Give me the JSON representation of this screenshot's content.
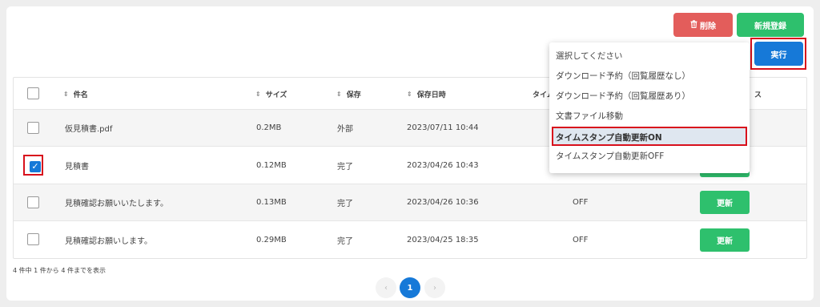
{
  "toolbar": {
    "delete_label": "削除",
    "new_label": "新規登録",
    "exec_label": "実行"
  },
  "table": {
    "headers": [
      "件名",
      "サイズ",
      "保存",
      "保存日時",
      "タイム",
      "ス"
    ],
    "rows": [
      {
        "name": "仮見積書.pdf",
        "size": "0.2MB",
        "storage": "外部",
        "date": "2023/07/11 10:44",
        "timestamp": "",
        "checked": false
      },
      {
        "name": "見積書",
        "size": "0.12MB",
        "storage": "完了",
        "date": "2023/04/26 10:43",
        "timestamp": "",
        "checked": true
      },
      {
        "name": "見積確認お願いいたします。",
        "size": "0.13MB",
        "storage": "完了",
        "date": "2023/04/26 10:36",
        "timestamp": "OFF",
        "checked": false
      },
      {
        "name": "見積確認お願いします。",
        "size": "0.29MB",
        "storage": "完了",
        "date": "2023/04/25 18:35",
        "timestamp": "OFF",
        "checked": false
      }
    ],
    "update_label": "更新"
  },
  "dropdown": {
    "options": [
      "選択してください",
      "ダウンロード予約（回覧履歴なし）",
      "ダウンロード予約（回覧履歴あり）",
      "文書ファイル移動",
      "タイムスタンプ自動更新ON",
      "タイムスタンプ自動更新OFF"
    ],
    "selected_index": 4
  },
  "summary": "4 件中 1 件から 4 件までを表示",
  "pagination": {
    "prev": "‹",
    "current": "1",
    "next": "›"
  },
  "colors": {
    "danger": "#e35d5b",
    "success": "#2ec06d",
    "primary": "#1679d8",
    "highlight": "#d8101c"
  }
}
